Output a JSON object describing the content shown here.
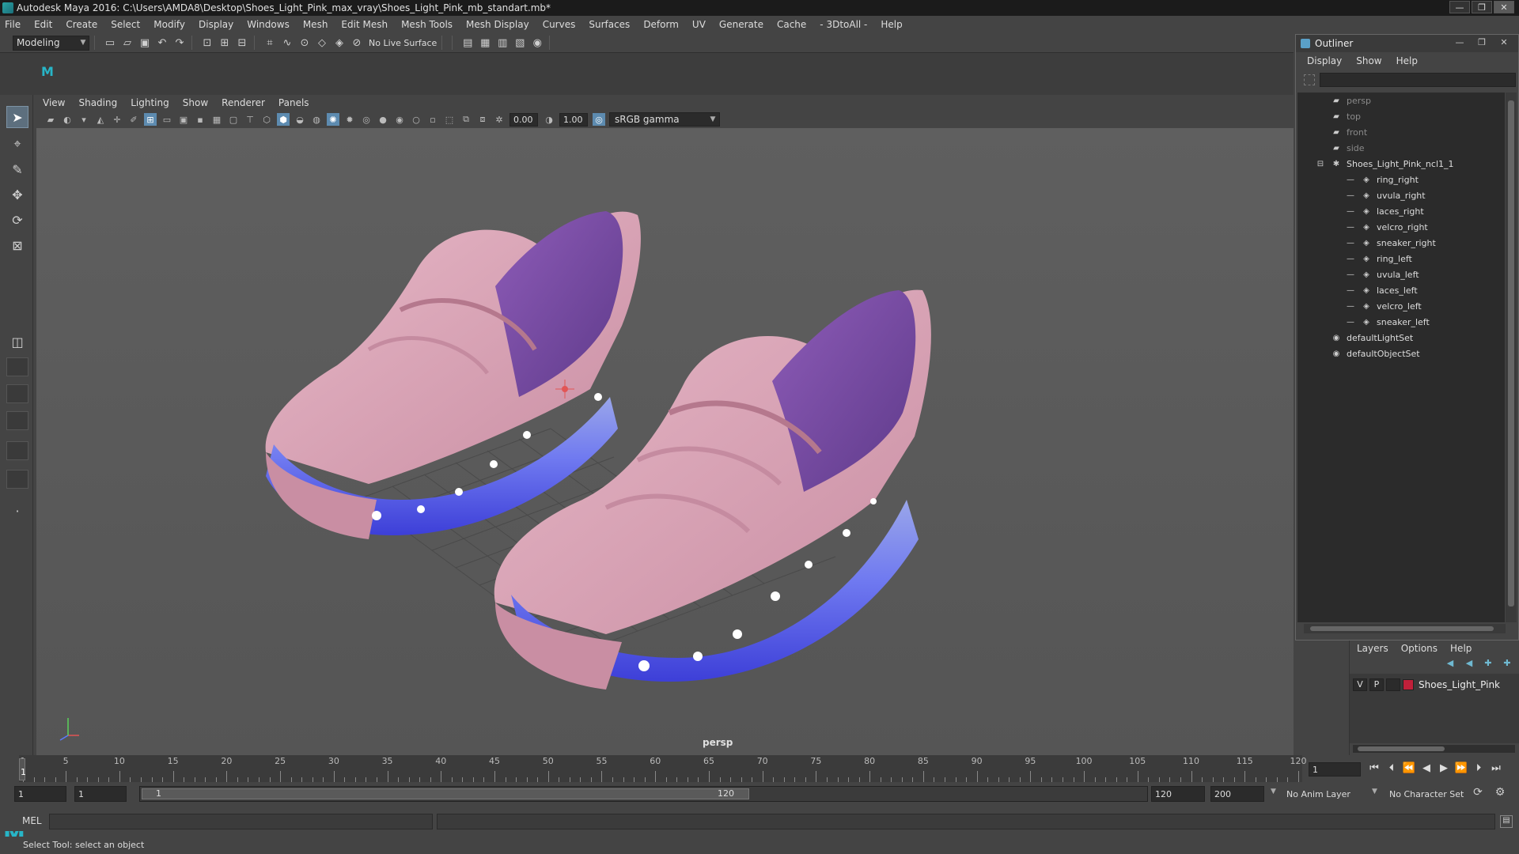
{
  "window": {
    "title": "Autodesk Maya 2016: C:\\Users\\AMDA8\\Desktop\\Shoes_Light_Pink_max_vray\\Shoes_Light_Pink_mb_standart.mb*",
    "minimize": "—",
    "maximize": "❐",
    "close": "✕"
  },
  "menubar": [
    "File",
    "Edit",
    "Create",
    "Select",
    "Modify",
    "Display",
    "Windows",
    "Mesh",
    "Edit Mesh",
    "Mesh Tools",
    "Mesh Display",
    "Curves",
    "Surfaces",
    "Deform",
    "UV",
    "Generate",
    "Cache",
    "- 3DtoAll -",
    "Help"
  ],
  "status_line": {
    "mode": "Modeling",
    "live_surface": "No Live Surface"
  },
  "panel": {
    "menu": [
      "View",
      "Shading",
      "Lighting",
      "Show",
      "Renderer",
      "Panels"
    ],
    "exposure": "0.00",
    "gamma_value": "1.00",
    "color_space": "sRGB gamma",
    "camera": "persp"
  },
  "outliner": {
    "title": "Outliner",
    "menu": [
      "Display",
      "Show",
      "Help"
    ],
    "items": [
      {
        "label": "persp",
        "type": "camera",
        "depth": 1,
        "dim": true
      },
      {
        "label": "top",
        "type": "camera",
        "depth": 1,
        "dim": true
      },
      {
        "label": "front",
        "type": "camera",
        "depth": 1,
        "dim": true
      },
      {
        "label": "side",
        "type": "camera",
        "depth": 1,
        "dim": true
      },
      {
        "label": "Shoes_Light_Pink_ncl1_1",
        "type": "group",
        "depth": 1,
        "dim": false,
        "expanded": true
      },
      {
        "label": "ring_right",
        "type": "mesh",
        "depth": 2,
        "dim": false
      },
      {
        "label": "uvula_right",
        "type": "mesh",
        "depth": 2,
        "dim": false
      },
      {
        "label": "laces_right",
        "type": "mesh",
        "depth": 2,
        "dim": false
      },
      {
        "label": "velcro_right",
        "type": "mesh",
        "depth": 2,
        "dim": false
      },
      {
        "label": "sneaker_right",
        "type": "mesh",
        "depth": 2,
        "dim": false
      },
      {
        "label": "ring_left",
        "type": "mesh",
        "depth": 2,
        "dim": false
      },
      {
        "label": "uvula_left",
        "type": "mesh",
        "depth": 2,
        "dim": false
      },
      {
        "label": "laces_left",
        "type": "mesh",
        "depth": 2,
        "dim": false
      },
      {
        "label": "velcro_left",
        "type": "mesh",
        "depth": 2,
        "dim": false
      },
      {
        "label": "sneaker_left",
        "type": "mesh",
        "depth": 2,
        "dim": false
      },
      {
        "label": "defaultLightSet",
        "type": "set",
        "depth": 1,
        "dim": false
      },
      {
        "label": "defaultObjectSet",
        "type": "set",
        "depth": 1,
        "dim": false
      }
    ]
  },
  "layers": {
    "menu": [
      "Layers",
      "Options",
      "Help"
    ],
    "rows": [
      {
        "visible": "V",
        "playback": "P",
        "name": "Shoes_Light_Pink",
        "color": "#c0203a"
      }
    ]
  },
  "timeline": {
    "ticks": [
      1,
      5,
      10,
      15,
      20,
      25,
      30,
      35,
      40,
      45,
      50,
      55,
      60,
      65,
      70,
      75,
      80,
      85,
      90,
      95,
      100,
      105,
      110,
      115,
      120
    ],
    "current_frame": "1",
    "frame_field": "1"
  },
  "range": {
    "start": "1",
    "playback_start": "1",
    "slider_start": "1",
    "slider_end": "120",
    "playback_end": "120",
    "end": "200",
    "anim_layer": "No Anim Layer",
    "character_set": "No Character Set"
  },
  "command": {
    "label": "MEL"
  },
  "help_line": "Select Tool: select an object",
  "colors": {
    "shoe_upper": "#d9a3b5",
    "shoe_purple": "#7a4fa0",
    "sole_blue": "#5a5ff0",
    "accent": "#27b5c7"
  }
}
